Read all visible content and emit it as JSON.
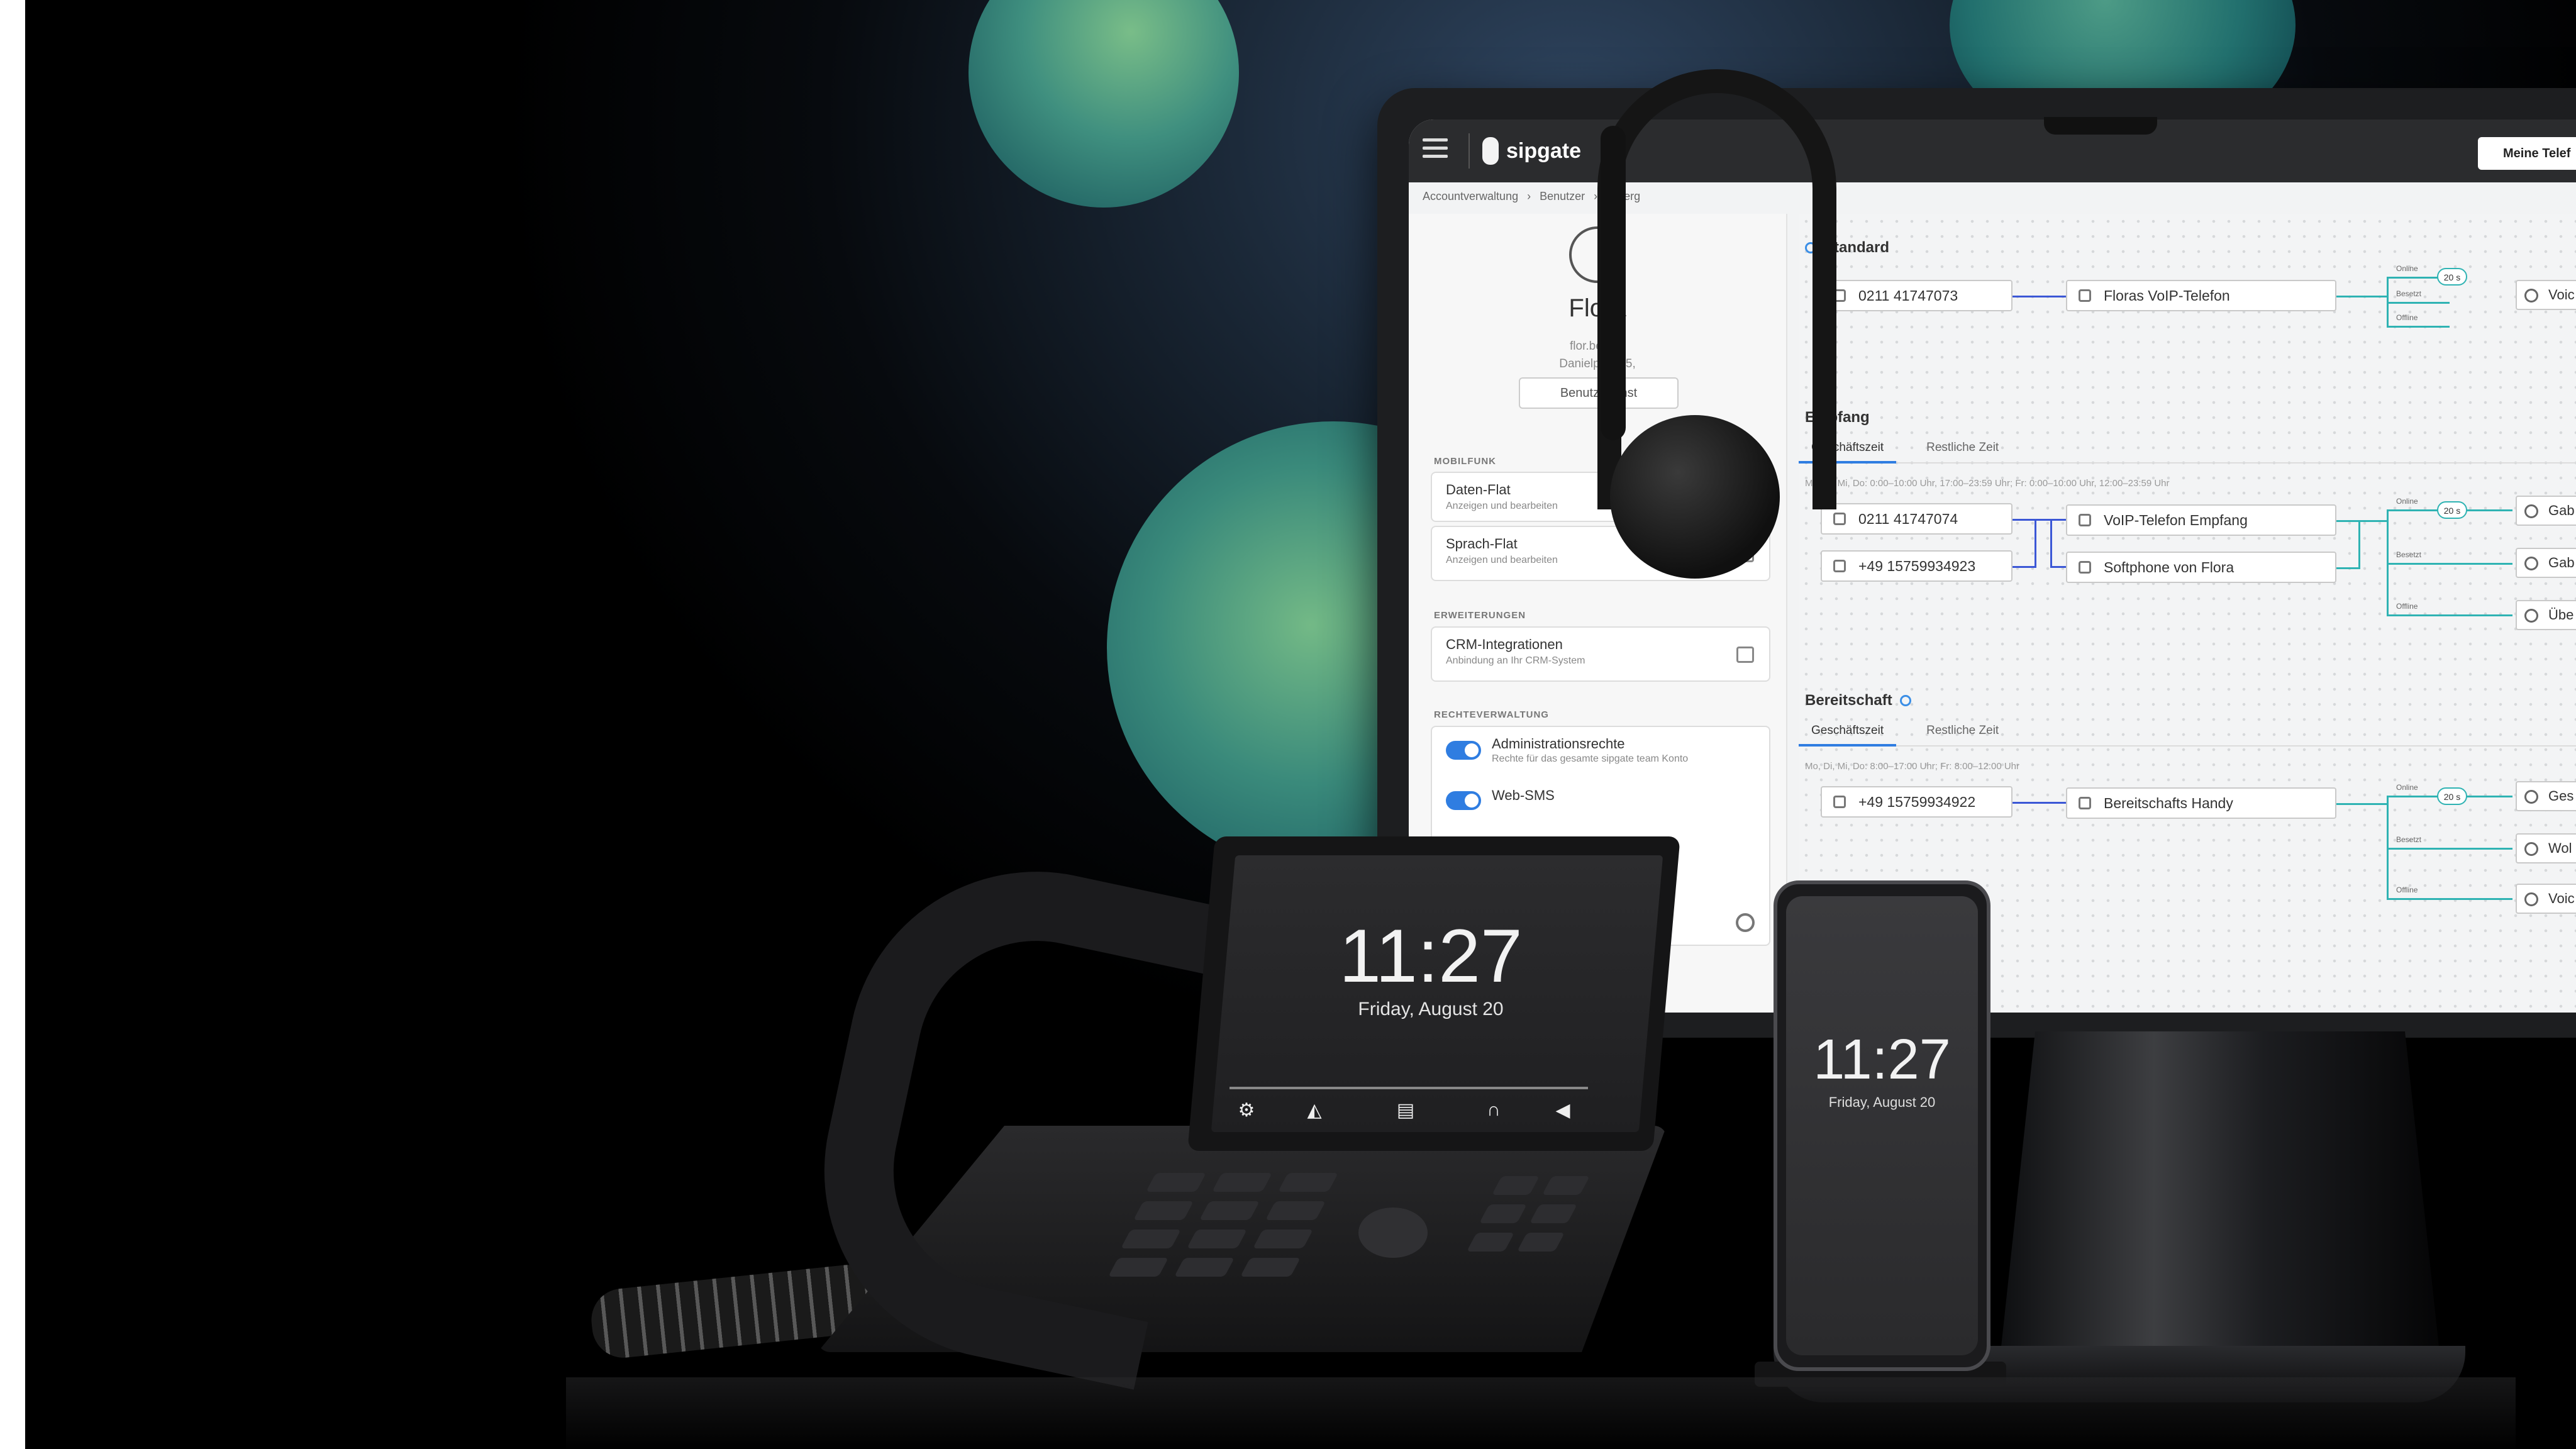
{
  "app": {
    "brand": "sipgate",
    "header_button": "Meine Telef",
    "breadcrumb": [
      "Accountverwaltung",
      "›",
      "Benutzer",
      "›",
      "…berg"
    ]
  },
  "profile": {
    "name": "Flora",
    "email": "flor.berg@",
    "address": "Danielpstr. 45,",
    "settings_button": "Benutzereinst"
  },
  "sidebar": {
    "mobilfunk_title": "MOBILFUNK",
    "daten_flat": {
      "title": "Daten-Flat",
      "sub": "Anzeigen und bearbeiten"
    },
    "sprach_flat": {
      "title": "Sprach-Flat",
      "sub": "Anzeigen und bearbeiten"
    },
    "erweiterungen_title": "ERWEITERUNGEN",
    "crm": {
      "title": "CRM-Integrationen",
      "sub": "Anbindung an Ihr CRM-System"
    },
    "rechte_title": "RECHTEVERWALTUNG",
    "admin": {
      "title": "Administrationsrechte",
      "sub": "Rechte für das gesamte sipgate team Konto"
    },
    "websms": {
      "title": "Web-SMS"
    }
  },
  "routing": {
    "standard": {
      "title": "Standard",
      "number": "0211 41747073",
      "device": "Floras VoIP-Telefon",
      "conditions": [
        "Online",
        "Besetzt",
        "Offline"
      ],
      "timer": "20 s",
      "end": "Voic"
    },
    "empfang": {
      "title": "Empfang",
      "tabs": [
        "Geschäftszeit",
        "Restliche Zeit"
      ],
      "hours": "Mo, Di, Mi, Do: 0:00–10:00 Uhr, 17:00–23:59 Uhr; Fr: 0:00–10:00 Uhr, 12:00–23:59 Uhr",
      "numbers": [
        "0211 41747074",
        "+49 15759934923"
      ],
      "devices": [
        "VoIP-Telefon Empfang",
        "Softphone von Flora"
      ],
      "conditions": [
        "Online",
        "Besetzt",
        "Offline"
      ],
      "timer": "20 s",
      "ends": [
        "Gab",
        "Gab",
        "Übe"
      ]
    },
    "bereitschaft": {
      "title": "Bereitschaft",
      "tabs": [
        "Geschäftszeit",
        "Restliche Zeit"
      ],
      "hours": "Mo, Di, Mi, Do: 8:00–17:00 Uhr; Fr: 8:00–12:00 Uhr",
      "number": "+49 15759934922",
      "device": "Bereitschafts Handy",
      "conditions": [
        "Online",
        "Besetzt",
        "Offline"
      ],
      "timer": "20 s",
      "ends": [
        "Ges",
        "Wol",
        "Voic"
      ]
    }
  },
  "desk_phone": {
    "time": "11:27",
    "date": "Friday, August 20",
    "icons": [
      "gear-icon",
      "nav-icon",
      "book-icon",
      "headset-icon",
      "speaker-icon"
    ]
  },
  "mobile_phone": {
    "time": "11:27",
    "date": "Friday, August 20"
  },
  "colors": {
    "accent_blue": "#2f7de1",
    "wire_blue": "#3b57d6",
    "wire_teal": "#2fb3b3",
    "bubble_green": "#6fb885"
  }
}
